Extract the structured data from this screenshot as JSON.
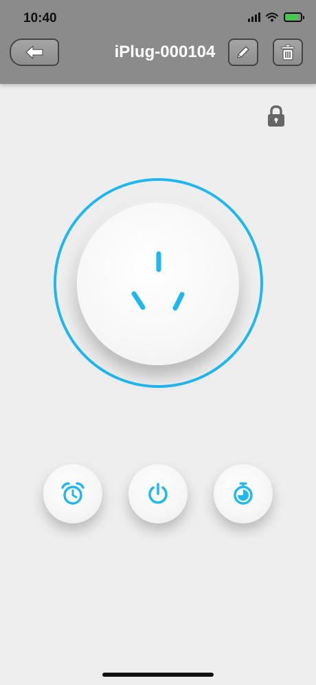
{
  "status_bar": {
    "time": "10:40"
  },
  "header": {
    "title": "iPlug-000104",
    "background_color": "#8b8b8b"
  },
  "icons": {
    "back": "back-arrow-icon",
    "edit": "pencil-icon",
    "delete": "trash-icon",
    "lock": "lock-icon",
    "socket": "socket-icon",
    "timer": "alarm-clock-icon",
    "power": "power-icon",
    "countdown": "stopwatch-icon"
  },
  "colors": {
    "accent": "#1fb8ee",
    "background": "#eeeeee"
  }
}
